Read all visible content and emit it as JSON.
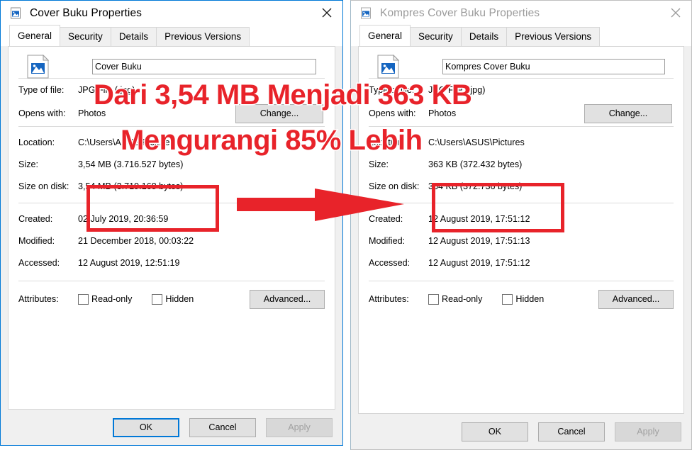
{
  "left_window": {
    "title": "Cover Buku Properties",
    "active": true,
    "icon": "picture-file-icon",
    "close_label": "✕",
    "tabs": [
      {
        "label": "General",
        "active": true
      },
      {
        "label": "Security",
        "active": false
      },
      {
        "label": "Details",
        "active": false
      },
      {
        "label": "Previous Versions",
        "active": false
      }
    ],
    "file_name": "Cover Buku",
    "fields": {
      "type_of_file_label": "Type of file:",
      "type_of_file_value": "JPG File (.jpg)",
      "opens_with_label": "Opens with:",
      "opens_with_value": "Photos",
      "change_button": "Change...",
      "location_label": "Location:",
      "location_value": "C:\\Users\\ASUS\\Pictures",
      "size_label": "Size:",
      "size_value": "3,54 MB (3.716.527 bytes)",
      "size_on_disk_label": "Size on disk:",
      "size_on_disk_value": "3,54 MB (3.719.168 bytes)",
      "created_label": "Created:",
      "created_value": "02 July 2019, 20:36:59",
      "modified_label": "Modified:",
      "modified_value": "21 December 2018, 00:03:22",
      "accessed_label": "Accessed:",
      "accessed_value": "12 August 2019, 12:51:19",
      "attributes_label": "Attributes:",
      "read_only_label": "Read-only",
      "hidden_label": "Hidden",
      "advanced_button": "Advanced..."
    },
    "buttons": {
      "ok": "OK",
      "cancel": "Cancel",
      "apply": "Apply"
    }
  },
  "right_window": {
    "title": "Kompres Cover Buku Properties",
    "active": false,
    "icon": "picture-file-icon",
    "close_label": "✕",
    "tabs": [
      {
        "label": "General",
        "active": true
      },
      {
        "label": "Security",
        "active": false
      },
      {
        "label": "Details",
        "active": false
      },
      {
        "label": "Previous Versions",
        "active": false
      }
    ],
    "file_name": "Kompres Cover Buku",
    "fields": {
      "type_of_file_label": "Type of file:",
      "type_of_file_value": "JPG File (.jpg)",
      "opens_with_label": "Opens with:",
      "opens_with_value": "Photos",
      "change_button": "Change...",
      "location_label": "Location:",
      "location_value": "C:\\Users\\ASUS\\Pictures",
      "size_label": "Size:",
      "size_value": "363 KB (372.432 bytes)",
      "size_on_disk_label": "Size on disk:",
      "size_on_disk_value": "364 KB (372.736 bytes)",
      "created_label": "Created:",
      "created_value": "12 August 2019, 17:51:12",
      "modified_label": "Modified:",
      "modified_value": "12 August 2019, 17:51:13",
      "accessed_label": "Accessed:",
      "accessed_value": "12 August 2019, 17:51:12",
      "attributes_label": "Attributes:",
      "read_only_label": "Read-only",
      "hidden_label": "Hidden",
      "advanced_button": "Advanced..."
    },
    "buttons": {
      "ok": "OK",
      "cancel": "Cancel",
      "apply": "Apply"
    }
  },
  "annotations": {
    "headline": "Dari 3,54 MB Menjadi 363 KB",
    "subline": "Mengurangi 85% Lebih",
    "color": "#e8232a",
    "highlight_box_left": "size-highlight-left",
    "highlight_box_right": "size-highlight-right",
    "arrow": "right-arrow"
  }
}
